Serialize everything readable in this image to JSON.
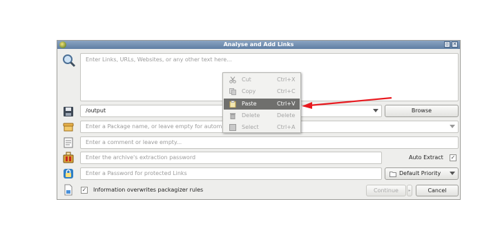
{
  "window": {
    "title": "Analyse and Add Links",
    "restore_icon": "▫",
    "close_icon": "✕"
  },
  "links_input": {
    "placeholder": "Enter Links, URLs, Websites, or any other text here..."
  },
  "folder": {
    "value": "/output",
    "browse_label": "Browse"
  },
  "package": {
    "placeholder": "Enter a Package name, or leave empty for automatic packaging"
  },
  "comment": {
    "placeholder": "Enter a comment or leave empty..."
  },
  "extract_password": {
    "placeholder": "Enter the archive's extraction password",
    "auto_extract_label": "Auto Extract",
    "auto_extract_checked": true
  },
  "download_password": {
    "placeholder": "Enter a Password for protected Links",
    "priority_label": "Default Priority"
  },
  "footer": {
    "overwrite_label": "Information overwrites packagizer rules",
    "overwrite_checked": true,
    "continue_label": "Continue",
    "cancel_label": "Cancel"
  },
  "context_menu": {
    "items": [
      {
        "label": "Cut",
        "shortcut": "Ctrl+X",
        "icon": "scissors-icon",
        "enabled": false
      },
      {
        "label": "Copy",
        "shortcut": "Ctrl+C",
        "icon": "copy-icon",
        "enabled": false
      },
      {
        "label": "Paste",
        "shortcut": "Ctrl+V",
        "icon": "paste-icon",
        "enabled": true,
        "highlighted": true
      },
      {
        "label": "Delete",
        "shortcut": "Delete",
        "icon": "delete-icon",
        "enabled": false
      },
      {
        "label": "Select",
        "shortcut": "Ctrl+A",
        "icon": "select-all-icon",
        "enabled": false
      }
    ]
  },
  "colors": {
    "annotation_arrow": "#e8191f",
    "titlebar": "#6f8db1",
    "menu_highlight": "#6f6f6d"
  }
}
